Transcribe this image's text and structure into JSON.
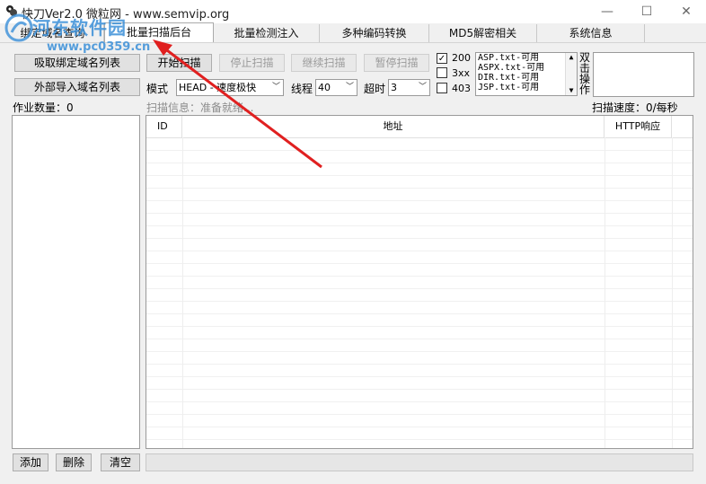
{
  "window": {
    "title": "快刀Ver2.0   微粒网 - www.semvip.org",
    "minimize": "—",
    "maximize": "☐",
    "close": "✕"
  },
  "tabs": [
    {
      "label": "绑定域名查询"
    },
    {
      "label": "批量扫描后台",
      "active": true
    },
    {
      "label": "批量检测注入"
    },
    {
      "label": "多种编码转换"
    },
    {
      "label": "MD5解密相关"
    },
    {
      "label": "系统信息"
    }
  ],
  "left_panel": {
    "fetch_button": "吸取绑定域名列表",
    "import_button": "外部导入域名列表",
    "job_count_label": "作业数量：0",
    "add_button": "添加",
    "delete_button": "删除",
    "clear_button": "清空"
  },
  "scan": {
    "start_button": "开始扫描",
    "stop_button": "停止扫描",
    "continue_button": "继续扫描",
    "pause_button": "暂停扫描",
    "mode_label": "模式",
    "mode_value": "HEAD - 速度极快",
    "threads_label": "线程",
    "threads_value": "40",
    "timeout_label": "超时",
    "timeout_value": "3",
    "status_checks": [
      {
        "label": "200",
        "checked": true
      },
      {
        "label": "3xx",
        "checked": false
      },
      {
        "label": "403",
        "checked": false
      }
    ],
    "dict_list": [
      "ASP.txt-可用",
      "ASPX.txt-可用",
      "DIR.txt-可用",
      "JSP.txt-可用"
    ],
    "dblclick_label": "双击操作",
    "info_label": "扫描信息：准备就绪...",
    "speed_label": "扫描速度：0/每秒"
  },
  "table": {
    "columns": [
      "ID",
      "地址",
      "HTTP响应"
    ]
  },
  "watermark": {
    "title": "河东软件园",
    "url": "www.pc0359.cn"
  },
  "colors": {
    "watermark": "#3a8fd8",
    "annotation_arrow": "#e02020"
  }
}
